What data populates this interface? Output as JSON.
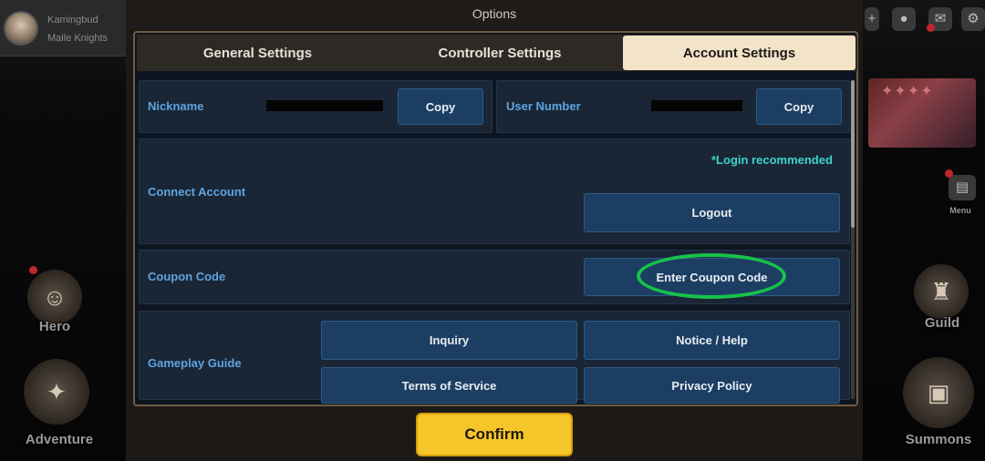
{
  "window": {
    "title": "Options"
  },
  "player": {
    "name": "Kamingbud",
    "guild": "Maile Knights"
  },
  "tabs": [
    {
      "label": "General Settings",
      "active": false
    },
    {
      "label": "Controller Settings",
      "active": false
    },
    {
      "label": "Account Settings",
      "active": true
    }
  ],
  "account": {
    "nickname_label": "Nickname",
    "nickname_copy": "Copy",
    "user_number_label": "User Number",
    "user_number_copy": "Copy",
    "connect_label": "Connect Account",
    "login_note": "*Login recommended",
    "logout_label": "Logout",
    "coupon_label": "Coupon Code",
    "coupon_button": "Enter Coupon Code",
    "guide_label": "Gameplay Guide",
    "guide_buttons": {
      "inquiry": "Inquiry",
      "notice": "Notice / Help",
      "terms": "Terms of Service",
      "privacy": "Privacy Policy"
    }
  },
  "side": {
    "hero": "Hero",
    "adventure": "Adventure",
    "guild": "Guild",
    "summons": "Summons",
    "menu": "Menu"
  },
  "confirm_label": "Confirm",
  "colors": {
    "accent_blue_text": "#5ea4df",
    "button_blue": "#1c3e63",
    "active_tab": "#f3e4c9",
    "confirm_yellow": "#f6c52a",
    "login_note": "#3fd3c8",
    "highlight_ring": "#18c24a"
  }
}
